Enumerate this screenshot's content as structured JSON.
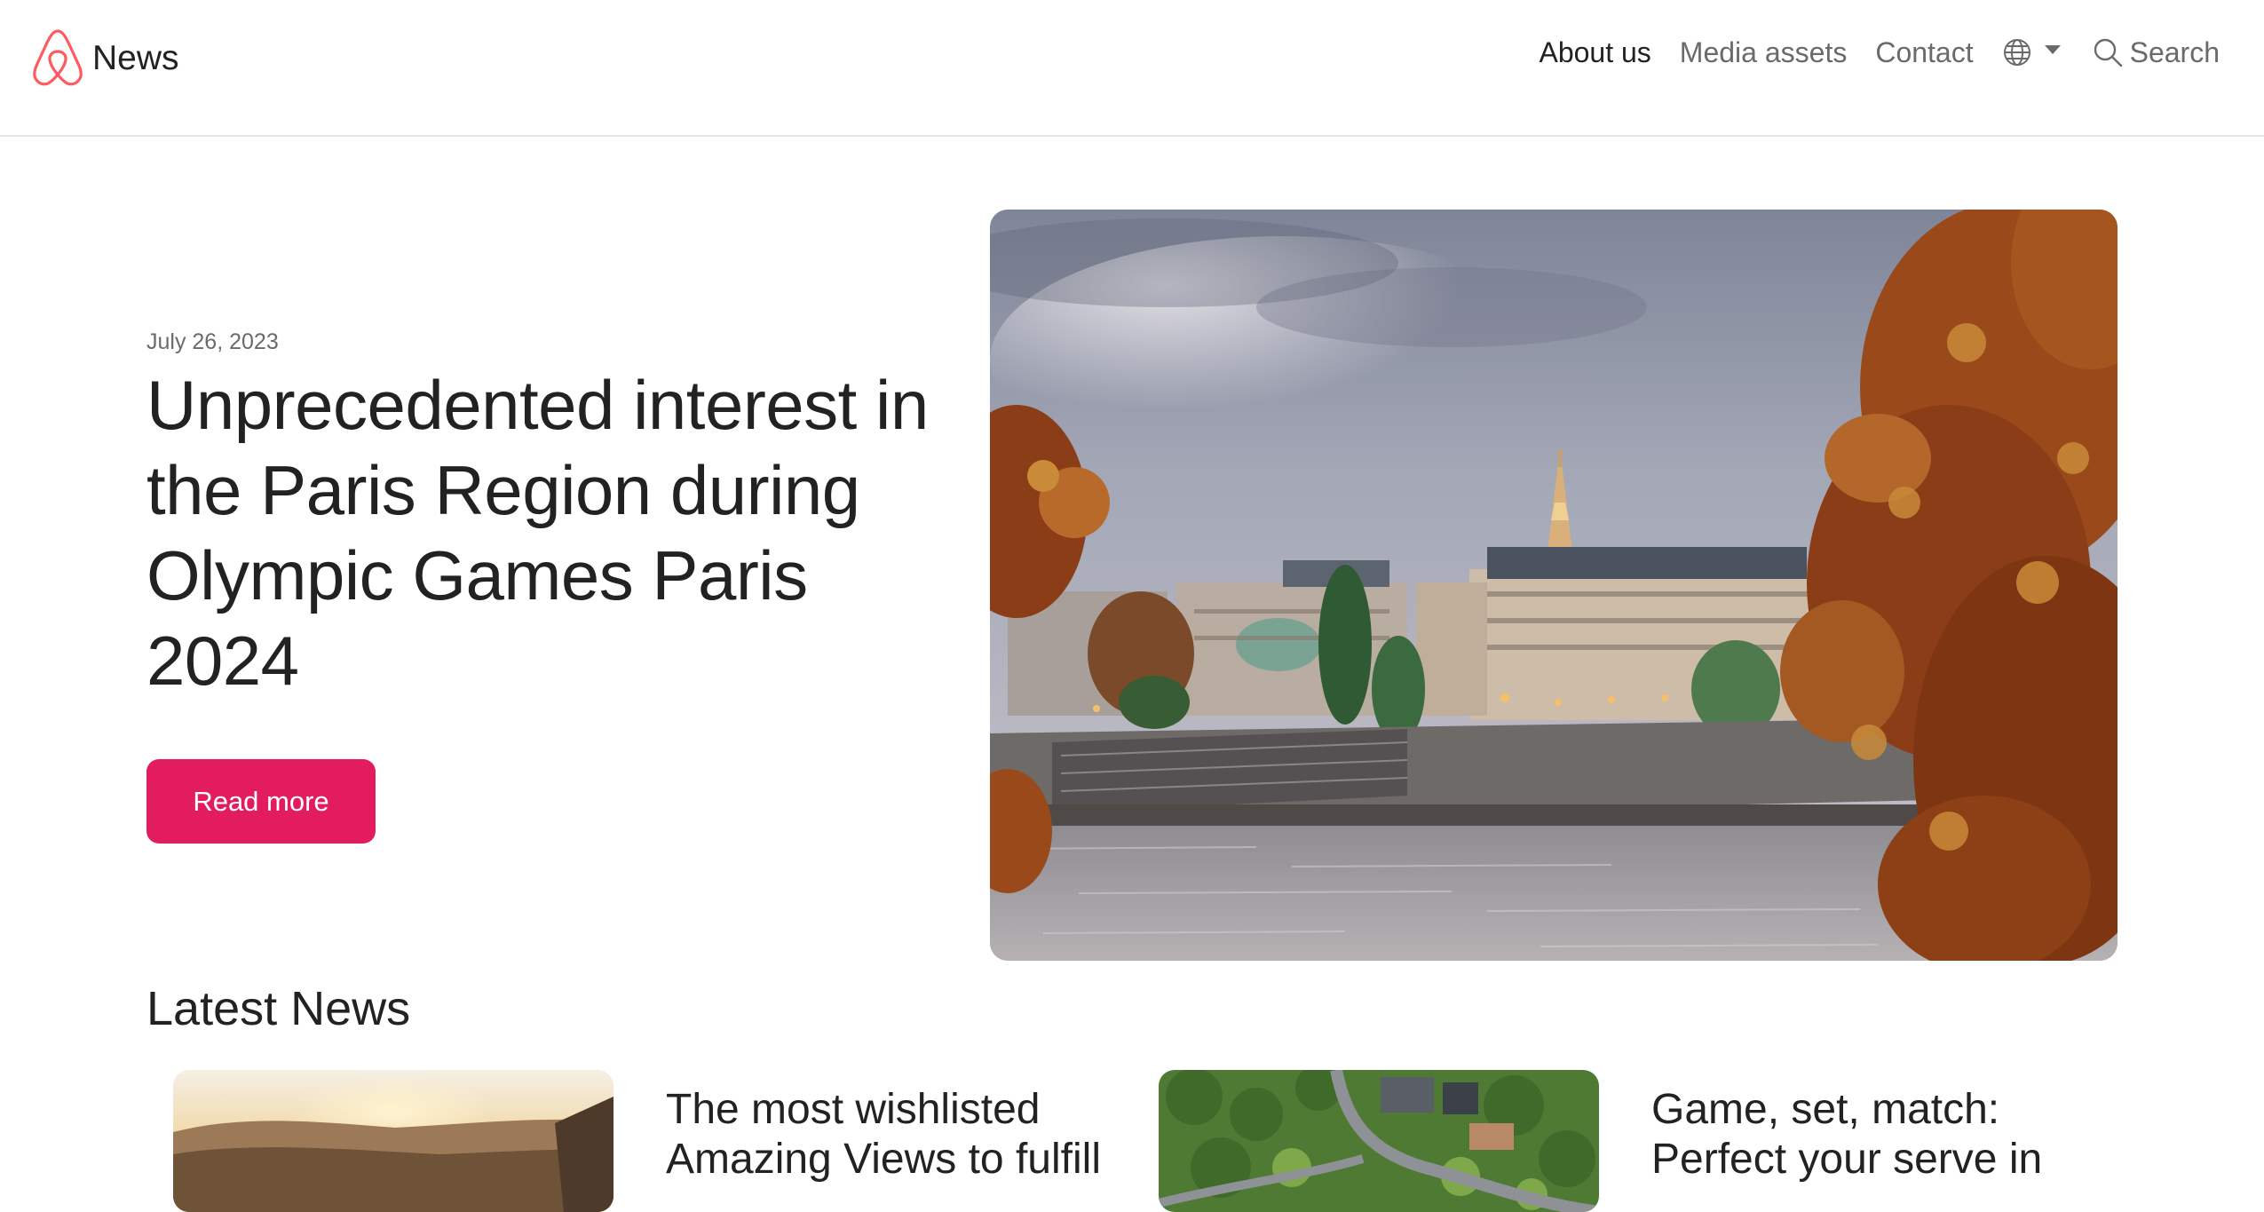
{
  "header": {
    "brand": "News",
    "nav": {
      "about": "About us",
      "media": "Media assets",
      "contact": "Contact"
    },
    "language_icon": "globe-icon",
    "search_label": "Search",
    "search_icon": "search-icon"
  },
  "hero": {
    "date": "July 26, 2023",
    "title": "Unprecedented interest in the Paris Region during Olympic Games Paris 2024",
    "button_label": "Read more",
    "image_label": "Seine river with Eiffel Tower and autumn leaves"
  },
  "latest": {
    "heading": "Latest News",
    "items": [
      {
        "title": "The most wishlisted Amazing Views to fulfill"
      },
      {
        "title": "Game, set, match: Perfect your serve in"
      }
    ]
  },
  "colors": {
    "accent": "#e31c5f",
    "text": "#222222",
    "muted": "#6a6a6a",
    "divider": "#e6e6e6"
  }
}
